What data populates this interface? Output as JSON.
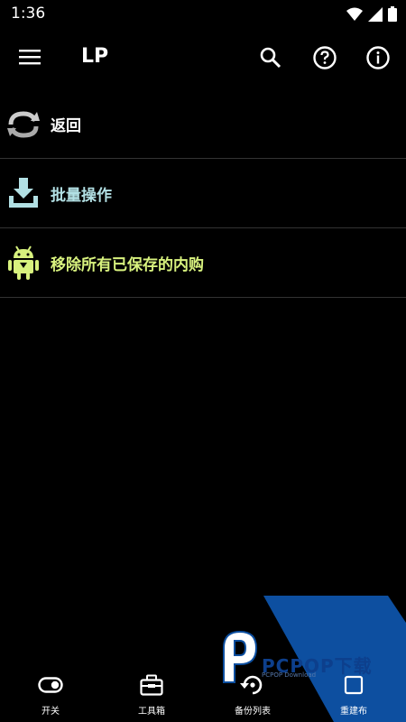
{
  "status": {
    "time": "1:36"
  },
  "app_bar": {
    "title": "LP"
  },
  "items": [
    {
      "label": "返回",
      "color": "#ffffff",
      "icon": "rotate-back-icon"
    },
    {
      "label": "批量操作",
      "color": "#b2e0e4",
      "icon": "download-tray-icon"
    },
    {
      "label": "移除所有已保存的内购",
      "color": "#d8f27e",
      "icon": "android-robot-icon"
    }
  ],
  "bottom_nav": [
    {
      "label": "开关",
      "icon": "toggle-icon"
    },
    {
      "label": "工具箱",
      "icon": "toolbox-icon"
    },
    {
      "label": "备份列表",
      "icon": "backup-restore-icon"
    },
    {
      "label": "重建布",
      "icon": "rebuild-icon"
    }
  ],
  "watermark": {
    "text": "PCPOP下载",
    "sub": "PCPOP Download"
  }
}
